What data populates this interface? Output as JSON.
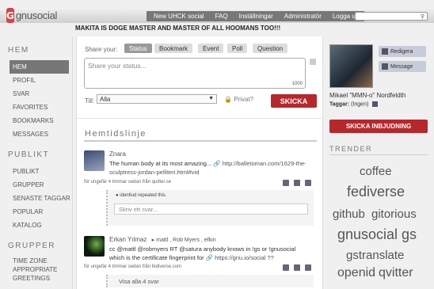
{
  "app": {
    "logo_text": "gnusocial"
  },
  "topnav": [
    "New UHCK social",
    "FAQ",
    "Inställningar",
    "Administratör",
    "Logga ut"
  ],
  "banner": "MAKITA IS DOGE MASTER AND MASTER OF ALL HOOMANS TOO!!!",
  "sidebar": {
    "sections": [
      {
        "title": "HEM",
        "items": [
          "HEM",
          "PROFIL",
          "SVAR",
          "FAVORITES",
          "BOOKMARKS",
          "MESSAGES"
        ]
      },
      {
        "title": "PUBLIKT",
        "items": [
          "PUBLIKT",
          "GRUPPER",
          "SENASTE TAGGAR",
          "POPULAR",
          "KATALOG"
        ]
      },
      {
        "title": "GRUPPER",
        "items": [
          "TIME ZONE",
          "APPROPRIATE",
          "GREETINGS"
        ]
      }
    ],
    "selected": "HEM"
  },
  "composer": {
    "share_label": "Share your:",
    "tabs": [
      "Status",
      "Bookmark",
      "Event",
      "Poll",
      "Question"
    ],
    "placeholder": "Share your status...",
    "char_count": "1000",
    "to_label": "Till:",
    "to_value": "Alla",
    "private_label": "Privat?",
    "send_label": "SKICKA"
  },
  "timeline": {
    "title": "Hemtidslinje",
    "notices": [
      {
        "author": "Znara",
        "text": "The human body at its most amazing...",
        "link": "http://balletoman.com/1629-the-sculptress-jordan-pelliteri.html#vid",
        "meta": "för ungefär 4 timmar sedan från quitter.se",
        "repeated": "identlud repeated this.",
        "reply_placeholder": "Skriv ett svar..."
      },
      {
        "author": "Erkan Yılmaz",
        "recipients": "▸ mattl , Rob Myers , efkin",
        "text": "cc @mattl @robmyers RT @satura anybody knows in !gs or !gnusocial which is the certificate fingerprint for",
        "link": "https://gnu.io/social ??",
        "meta": "för ungefär 4 timmar sedan från fediverse.com",
        "show_all": "Visa alla 4 svar"
      }
    ]
  },
  "profile": {
    "name": "Mikael \"MMN-o\" Nordfeldth",
    "tags_label": "Taggar:",
    "tags_value": "(Ingen)",
    "edit_label": "Redigera",
    "message_label": "Message"
  },
  "invite_label": "SKICKA INBJUDNING",
  "trends": {
    "title": "TRENDER",
    "tags": [
      "coffee",
      "fediverse",
      "github",
      "gitorious",
      "gnusocial",
      "gs",
      "gstranslate",
      "openid",
      "qvitter"
    ]
  },
  "colors": {
    "accent": "#b5282c",
    "topnav": "#777777"
  }
}
